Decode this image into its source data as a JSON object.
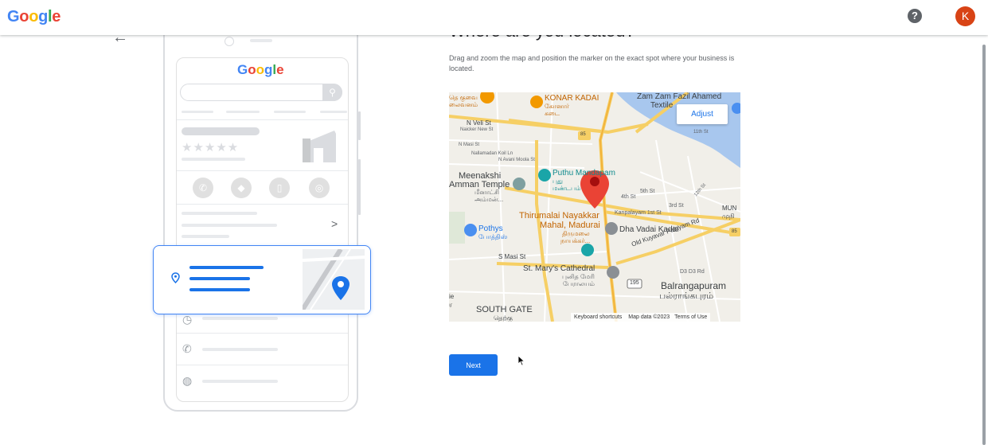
{
  "header": {
    "logo": {
      "G": "G",
      "o1": "o",
      "o2": "o",
      "g": "g",
      "l": "l",
      "e": "e"
    },
    "help_icon": "help-icon",
    "avatar_letter": "K"
  },
  "colors": {
    "primary": "#1a73e8",
    "avatar": "#d84315",
    "marker": "#ea4335"
  },
  "illustration": {
    "logo": {
      "G": "G",
      "o1": "o",
      "o2": "o",
      "g": "g",
      "l": "l",
      "e": "e"
    },
    "stars": "★★★★★",
    "chevron": ">"
  },
  "page": {
    "title": "Where are you located?",
    "description": "Drag and zoom the map and position the marker on the exact spot where your business is located.",
    "adjust_label": "Adjust",
    "next_label": "Next"
  },
  "map": {
    "labels": {
      "konar_kadai": "KONAR KADAI",
      "konar_kadai_ta": "கோனார்",
      "konar_kadai_ta2": "கடை",
      "zam_zam": "Zam Zam Fazil Ahamed",
      "textile": "Textile",
      "n_veli_st": "N Veli St",
      "naicker_new_st": "Naicker New St",
      "n_masi_st": "N Masi St",
      "nallamadan": "Nallamadan Koil Ln",
      "n_avani": "N Avani Moola St",
      "meenakshi": "Meenakshi",
      "amman_temple": "Amman Temple",
      "meenakshi_ta": "மீனாட்சி",
      "amman_ta": "அம்மன்...",
      "puthu_mandapam": "Puthu Mandapam",
      "puthu_ta": "புது",
      "mandapam_ta": "மண்டபம்",
      "fourth_st": "4th St",
      "fifth_st": "5th St",
      "third_st": "3rd St",
      "twelfth_st": "12th St",
      "eleventh_st": "11th St",
      "mun": "MUN",
      "mun_ta": "முநி",
      "thirumalai": "Thirumalai Nayakkar",
      "mahal": "Mahal, Madurai",
      "thirumalai_ta": "திருமலை",
      "nayakkar_ta": "நாயக்கர்...",
      "kanpalayam": "Kanpalayam 1st St",
      "pothys": "Pothys",
      "pothys_ta": "போத்திஸ்",
      "dha_vadai": "Dha Vadai Kadai",
      "s_masi_st": "S Masi St",
      "old_kuyavar": "Old Kuyavar Palayam Rd",
      "st_marys": "St. Mary's Cathedral",
      "st_marys_ta": "புனித மேரி",
      "st_marys_ta2": "பேராலயம்",
      "route_195": "195",
      "route_85": "85",
      "d3": "D3 D3 Rd",
      "balrangapuram": "Balrangapuram",
      "balrangapuram_ta": "பல்ராங்கபுரம்",
      "south_gate": "SOUTH GATE",
      "south_gate_ta": "தெற்கு",
      "top_left": "தெ குவை",
      "top_left2": "லைவனம்",
      "left_e": "ie",
      "left_r": "ர"
    },
    "footer": {
      "shortcuts": "Keyboard shortcuts",
      "data": "Map data ©2023",
      "terms": "Terms of Use"
    }
  }
}
